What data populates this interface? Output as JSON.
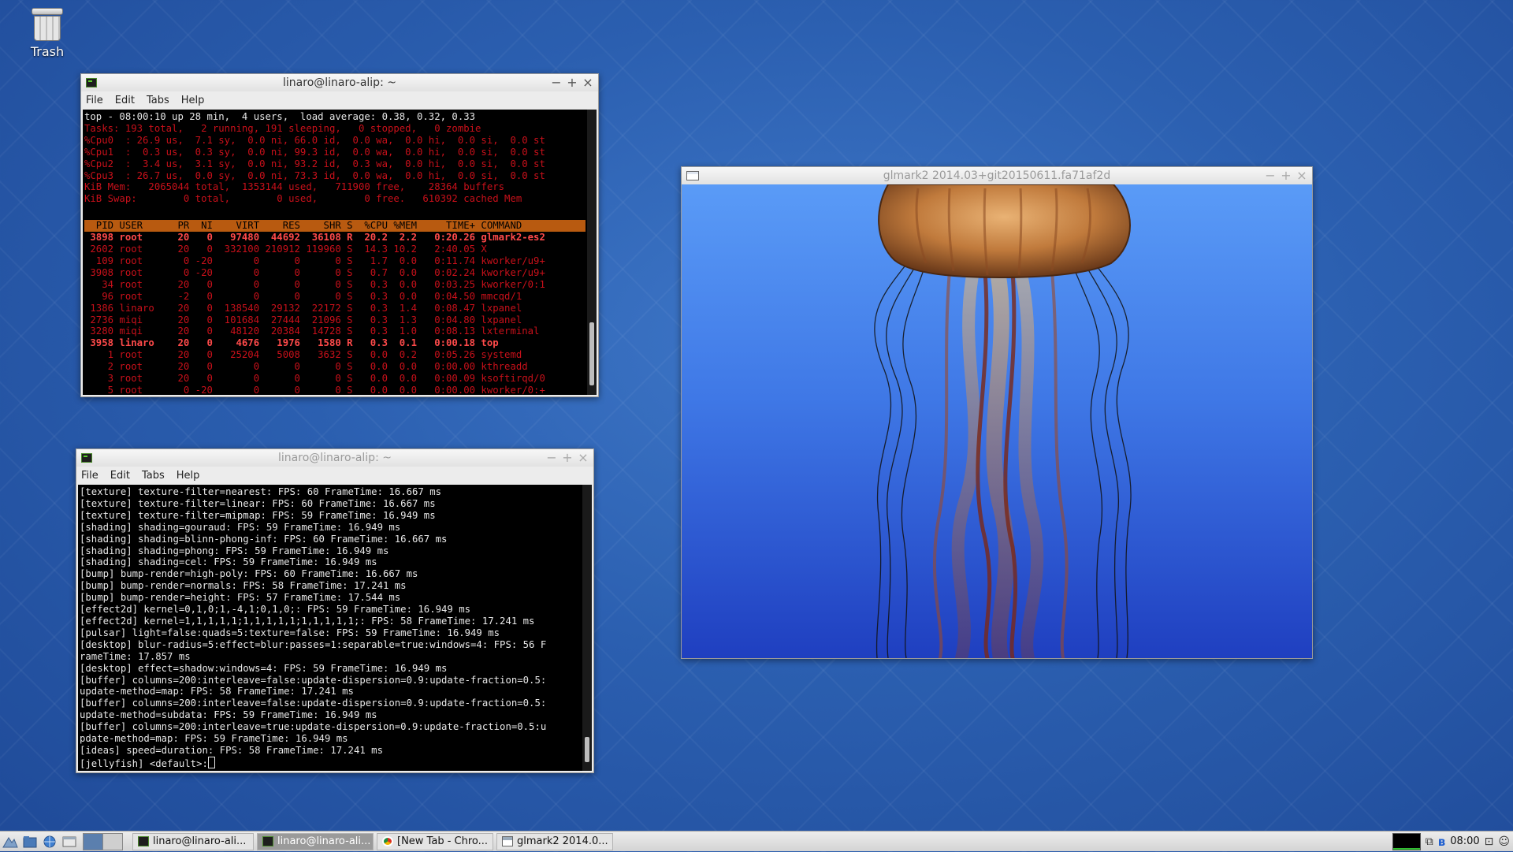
{
  "desktop": {
    "trash_label": "Trash"
  },
  "top_window": {
    "title": "linaro@linaro-alip: ~",
    "menu": [
      "File",
      "Edit",
      "Tabs",
      "Help"
    ],
    "summary": {
      "line1": "top - 08:00:10 up 28 min,  4 users,  load average: 0.38, 0.32, 0.33",
      "tasks": "Tasks: 193 total,   2 running, 191 sleeping,   0 stopped,   0 zombie",
      "cpu0": "%Cpu0  : 26.9 us,  7.1 sy,  0.0 ni, 66.0 id,  0.0 wa,  0.0 hi,  0.0 si,  0.0 st",
      "cpu1": "%Cpu1  :  0.3 us,  0.3 sy,  0.0 ni, 99.3 id,  0.0 wa,  0.0 hi,  0.0 si,  0.0 st",
      "cpu2": "%Cpu2  :  3.4 us,  3.1 sy,  0.0 ni, 93.2 id,  0.3 wa,  0.0 hi,  0.0 si,  0.0 st",
      "cpu3": "%Cpu3  : 26.7 us,  0.0 sy,  0.0 ni, 73.3 id,  0.0 wa,  0.0 hi,  0.0 si,  0.0 st",
      "mem": "KiB Mem:   2065044 total,  1353144 used,   711900 free,    28364 buffers",
      "swap": "KiB Swap:        0 total,        0 used,        0 free.   610392 cached Mem"
    },
    "header": "  PID USER      PR  NI    VIRT    RES    SHR S  %CPU %MEM     TIME+ COMMAND",
    "processes": [
      {
        "line": " 3898 root      20   0   97480  44692  36108 R  20.2  2.2   0:20.26 glmark2-es2",
        "style": "br"
      },
      {
        "line": " 2602 root      20   0  332100 210912 119960 S  14.3 10.2   2:40.05 X",
        "style": "r"
      },
      {
        "line": "  109 root       0 -20       0      0      0 S   1.7  0.0   0:11.74 kworker/u9+",
        "style": "r"
      },
      {
        "line": " 3908 root       0 -20       0      0      0 S   0.7  0.0   0:02.24 kworker/u9+",
        "style": "r"
      },
      {
        "line": "   34 root      20   0       0      0      0 S   0.3  0.0   0:03.25 kworker/0:1",
        "style": "r"
      },
      {
        "line": "   96 root      -2   0       0      0      0 S   0.3  0.0   0:04.50 mmcqd/1",
        "style": "r"
      },
      {
        "line": " 1386 linaro    20   0  138540  29132  22172 S   0.3  1.4   0:08.47 lxpanel",
        "style": "r"
      },
      {
        "line": " 2736 miqi      20   0  101684  27444  21096 S   0.3  1.3   0:04.80 lxpanel",
        "style": "r"
      },
      {
        "line": " 3280 miqi      20   0   48120  20384  14728 S   0.3  1.0   0:08.13 lxterminal",
        "style": "r"
      },
      {
        "line": " 3958 linaro    20   0    4676   1976   1580 R   0.3  0.1   0:00.18 top",
        "style": "br"
      },
      {
        "line": "    1 root      20   0   25204   5008   3632 S   0.0  0.2   0:05.26 systemd",
        "style": "r"
      },
      {
        "line": "    2 root      20   0       0      0      0 S   0.0  0.0   0:00.00 kthreadd",
        "style": "r"
      },
      {
        "line": "    3 root      20   0       0      0      0 S   0.0  0.0   0:00.09 ksoftirqd/0",
        "style": "r"
      },
      {
        "line": "    5 root       0 -20       0      0      0 S   0.0  0.0   0:00.00 kworker/0:+",
        "style": "r"
      }
    ]
  },
  "glmark_term": {
    "title": "linaro@linaro-alip: ~",
    "menu": [
      "File",
      "Edit",
      "Tabs",
      "Help"
    ],
    "lines": [
      "[texture] texture-filter=nearest: FPS: 60 FrameTime: 16.667 ms",
      "[texture] texture-filter=linear: FPS: 60 FrameTime: 16.667 ms",
      "[texture] texture-filter=mipmap: FPS: 59 FrameTime: 16.949 ms",
      "[shading] shading=gouraud: FPS: 59 FrameTime: 16.949 ms",
      "[shading] shading=blinn-phong-inf: FPS: 60 FrameTime: 16.667 ms",
      "[shading] shading=phong: FPS: 59 FrameTime: 16.949 ms",
      "[shading] shading=cel: FPS: 59 FrameTime: 16.949 ms",
      "[bump] bump-render=high-poly: FPS: 60 FrameTime: 16.667 ms",
      "[bump] bump-render=normals: FPS: 58 FrameTime: 17.241 ms",
      "[bump] bump-render=height: FPS: 57 FrameTime: 17.544 ms",
      "[effect2d] kernel=0,1,0;1,-4,1;0,1,0;: FPS: 59 FrameTime: 16.949 ms",
      "[effect2d] kernel=1,1,1,1,1;1,1,1,1,1;1,1,1,1,1;: FPS: 58 FrameTime: 17.241 ms",
      "[pulsar] light=false:quads=5:texture=false: FPS: 59 FrameTime: 16.949 ms",
      "[desktop] blur-radius=5:effect=blur:passes=1:separable=true:windows=4: FPS: 56 F",
      "rameTime: 17.857 ms",
      "[desktop] effect=shadow:windows=4: FPS: 59 FrameTime: 16.949 ms",
      "[buffer] columns=200:interleave=false:update-dispersion=0.9:update-fraction=0.5:",
      "update-method=map: FPS: 58 FrameTime: 17.241 ms",
      "[buffer] columns=200:interleave=false:update-dispersion=0.9:update-fraction=0.5:",
      "update-method=subdata: FPS: 59 FrameTime: 16.949 ms",
      "[buffer] columns=200:interleave=true:update-dispersion=0.9:update-fraction=0.5:u",
      "pdate-method=map: FPS: 59 FrameTime: 16.949 ms",
      "[ideas] speed=duration: FPS: 58 FrameTime: 17.241 ms",
      "[jellyfish] <default>:"
    ]
  },
  "glmark_window": {
    "title": "glmark2 2014.03+git20150611.fa71af2d"
  },
  "window_buttons": {
    "minimize": "−",
    "maximize": "+",
    "close": "×"
  },
  "taskbar": {
    "tasks": [
      {
        "label": "linaro@linaro-ali..."
      },
      {
        "label": "linaro@linaro-ali..."
      },
      {
        "label": "[New Tab - Chro..."
      },
      {
        "label": "glmark2 2014.0..."
      }
    ],
    "clock": "08:00"
  }
}
